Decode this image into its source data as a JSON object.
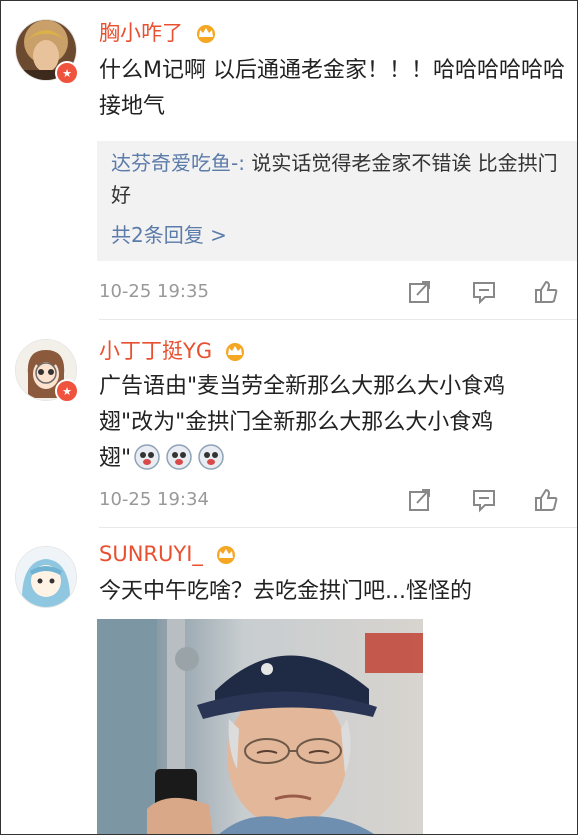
{
  "comments": [
    {
      "username": "胸小咋了",
      "text": "什么M记啊 以后通通老金家！！！哈哈哈哈哈哈接地气",
      "reply": {
        "user": "达芬奇爱吃鱼-:",
        "text": " 说实话觉得老金家不错诶 比金拱门好",
        "more": "共2条回复 >"
      },
      "time": "10-25 19:35"
    },
    {
      "username": "小丁丁挺YG",
      "text_line1": "广告语由\"麦当劳全新那么大那么大小食鸡",
      "text_line2": "翅\"改为\"金拱门全新那么大那么大小食鸡",
      "text_line3": "翅\"",
      "time": "10-25 19:34"
    },
    {
      "username": "SUNRUYI_",
      "text": "今天中午吃啥？去吃金拱门吧...怪怪的"
    }
  ],
  "icons": {
    "crown": "crown-badge-icon",
    "vip": "vip-star-icon",
    "repost": "repost-icon",
    "comment": "comment-icon",
    "like": "thumbs-up-icon",
    "emoji": "doge-emoji-icon"
  },
  "colors": {
    "username": "#e8502f",
    "link": "#5b7ba9",
    "meta": "#999999",
    "crown": "#f5a623"
  }
}
